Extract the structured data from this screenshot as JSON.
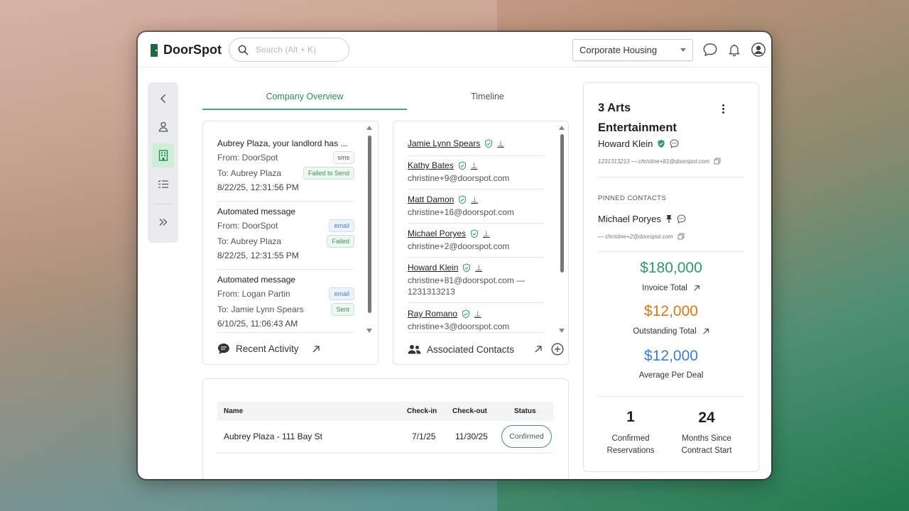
{
  "app": {
    "name": "DoorSpot"
  },
  "search": {
    "placeholder": "Search (Alt + K)"
  },
  "org_select": {
    "value": "Corporate Housing"
  },
  "tabs": [
    {
      "label": "Company Overview",
      "active": true
    },
    {
      "label": "Timeline",
      "active": false
    }
  ],
  "activity": {
    "items": [
      {
        "title": "Aubrey Plaza, your landlord has ...",
        "from": "From: DoorSpot",
        "from_badge": "sms",
        "to": "To: Aubrey Plaza",
        "to_badge": "Failed to Send",
        "time": "8/22/25, 12:31:56 PM"
      },
      {
        "title": "Automated message",
        "from": "From: DoorSpot",
        "from_badge": "email",
        "to": "To: Aubrey Plaza",
        "to_badge": "Failed",
        "time": "8/22/25, 12:31:55 PM"
      },
      {
        "title": "Automated message",
        "from": "From: Logan Partin",
        "from_badge": "email",
        "to": "To: Jamie Lynn Spears",
        "to_badge": "Sent",
        "time": "6/10/25, 11:06:43 AM"
      }
    ],
    "footer_label": "Recent Activity"
  },
  "contacts": {
    "items": [
      {
        "name": "Jamie Lynn Spears",
        "email": ""
      },
      {
        "name": "Kathy Bates",
        "email": "christine+9@doorspot.com"
      },
      {
        "name": "Matt Damon",
        "email": "christine+16@doorspot.com"
      },
      {
        "name": "Michael Poryes",
        "email": "christine+2@doorspot.com"
      },
      {
        "name": "Howard Klein",
        "email": "christine+81@doorspot.com —",
        "phone": "1231313213"
      },
      {
        "name": "Ray Romano",
        "email": "christine+3@doorspot.com"
      }
    ],
    "footer_label": "Associated Contacts"
  },
  "reservations": {
    "columns": [
      "Name",
      "Check-in",
      "Check-out",
      "Status"
    ],
    "rows": [
      {
        "name": "Aubrey Plaza - 111 Bay St",
        "check_in": "7/1/25",
        "check_out": "11/30/25",
        "status": "Confirmed"
      }
    ]
  },
  "company": {
    "name": "3 Arts Entertainment",
    "primary_contact": "Howard Klein",
    "primary_contact_sub": "1231313213 — christine+81@doorspot.com",
    "pinned_label": "PINNED CONTACTS",
    "pinned_contact": "Michael Poryes",
    "pinned_contact_sub": "— christine+2@doorspot.com",
    "invoice_total": "$180,000",
    "invoice_label": "Invoice Total",
    "outstanding_total": "$12,000",
    "outstanding_label": "Outstanding Total",
    "avg_per_deal": "$12,000",
    "avg_label": "Average Per Deal",
    "confirmed_reservations": "1",
    "confirmed_label": "Confirmed Reservations",
    "months_since": "24",
    "months_label": "Months Since Contract Start"
  },
  "colors": {
    "brand_green": "#1f6b41",
    "invoice_green": "#2e9a68",
    "outstanding_orange": "#d47a10",
    "avg_blue": "#3a7fd4"
  }
}
